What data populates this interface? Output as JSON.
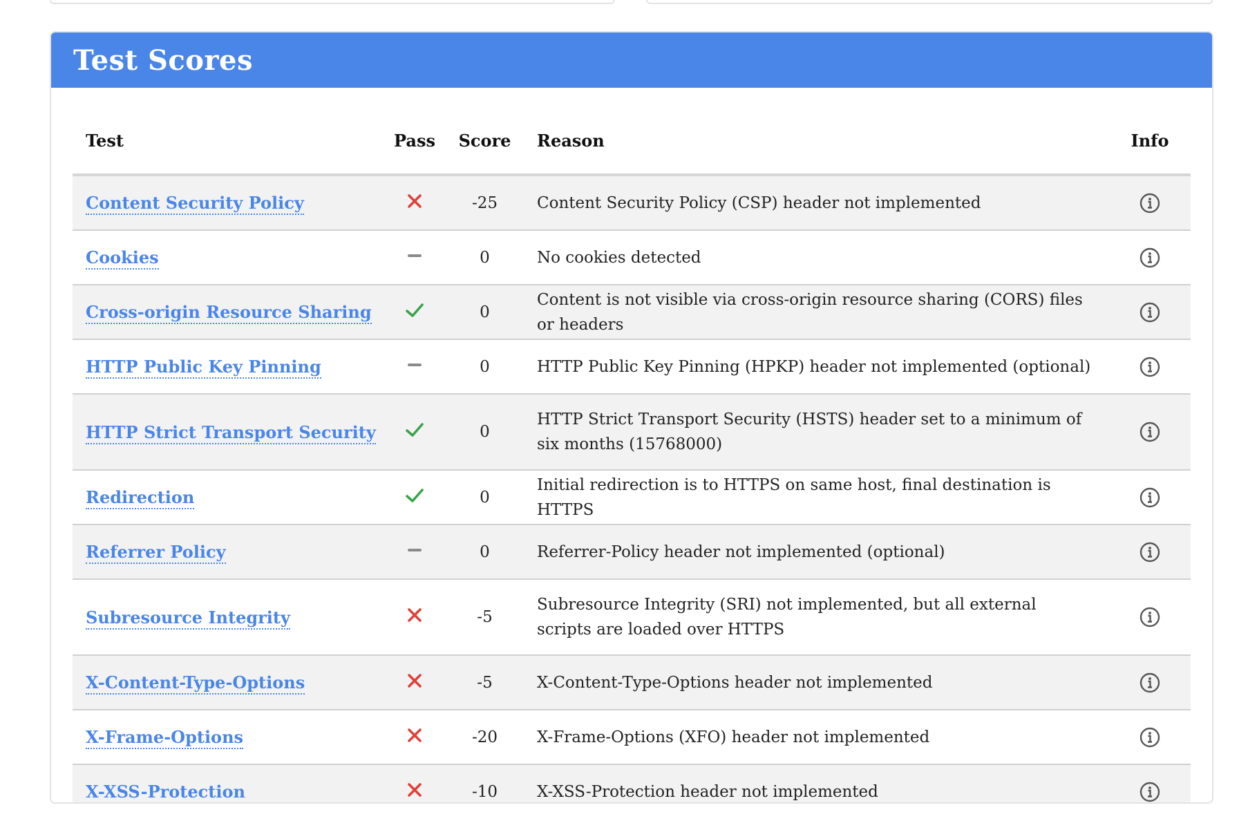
{
  "panel": {
    "title": "Test Scores"
  },
  "table": {
    "headers": {
      "test": "Test",
      "pass": "Pass",
      "score": "Score",
      "reason": "Reason",
      "info": "Info"
    },
    "rows": [
      {
        "test": "Content Security Policy",
        "pass": "fail",
        "score": "-25",
        "reason": "Content Security Policy (CSP) header not implemented"
      },
      {
        "test": "Cookies",
        "pass": "neutral",
        "score": "0",
        "reason": "No cookies detected"
      },
      {
        "test": "Cross-origin Resource Sharing",
        "pass": "pass",
        "score": "0",
        "reason": "Content is not visible via cross-origin resource sharing (CORS) files or headers"
      },
      {
        "test": "HTTP Public Key Pinning",
        "pass": "neutral",
        "score": "0",
        "reason": "HTTP Public Key Pinning (HPKP) header not implemented (optional)"
      },
      {
        "test": "HTTP Strict Transport Security",
        "pass": "pass",
        "score": "0",
        "reason": "HTTP Strict Transport Security (HSTS) header set to a minimum of six months (15768000)"
      },
      {
        "test": "Redirection",
        "pass": "pass",
        "score": "0",
        "reason": "Initial redirection is to HTTPS on same host, final destination is HTTPS"
      },
      {
        "test": "Referrer Policy",
        "pass": "neutral",
        "score": "0",
        "reason": "Referrer-Policy header not implemented (optional)"
      },
      {
        "test": "Subresource Integrity",
        "pass": "fail",
        "score": "-5",
        "reason": "Subresource Integrity (SRI) not implemented, but all external scripts are loaded over HTTPS"
      },
      {
        "test": "X-Content-Type-Options",
        "pass": "fail",
        "score": "-5",
        "reason": "X-Content-Type-Options header not implemented"
      },
      {
        "test": "X-Frame-Options",
        "pass": "fail",
        "score": "-20",
        "reason": "X-Frame-Options (XFO) header not implemented"
      },
      {
        "test": "X-XSS-Protection",
        "pass": "fail",
        "score": "-10",
        "reason": "X-XSS-Protection header not implemented"
      }
    ]
  },
  "icons": {
    "fail": "cross-icon",
    "neutral": "dash-icon",
    "pass": "check-icon",
    "info": "info-icon"
  },
  "colors": {
    "header_bg": "#4a86e8",
    "link": "#4a86e8",
    "fail": "#e0403a",
    "pass": "#3aa34a",
    "neutral": "#8a8a8a",
    "stripe": "#f2f2f2"
  }
}
